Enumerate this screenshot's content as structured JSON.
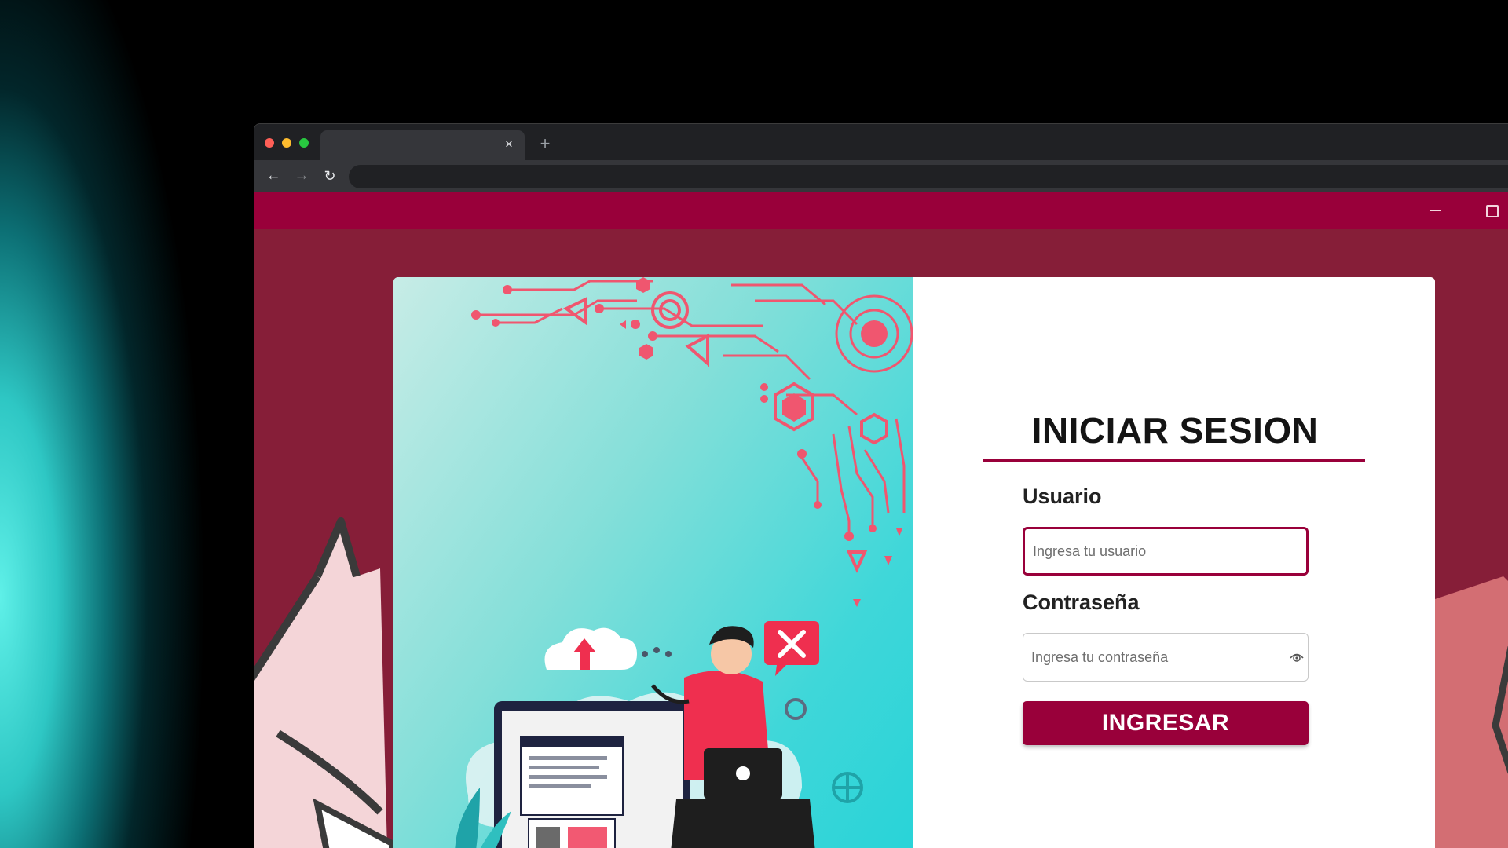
{
  "browser": {
    "tab_close_glyph": "×",
    "new_tab_glyph": "+",
    "nav_icons": [
      "back-arrow-icon",
      "forward-arrow-icon",
      "reload-icon"
    ],
    "back_glyph": "←",
    "forward_glyph": "→",
    "reload_glyph": "↻"
  },
  "app": {
    "window_controls": [
      "minimize-icon",
      "maximize-icon"
    ]
  },
  "login": {
    "title": "INICIAR SESION",
    "username_label": "Usuario",
    "username_placeholder": "Ingresa tu usuario",
    "password_label": "Contraseña",
    "password_placeholder": "Ingresa tu contraseña",
    "submit_label": "INGRESAR"
  },
  "colors": {
    "brand": "#99003a",
    "page_background": "#861e38",
    "illustration_gradient_start": "#c7ece6",
    "illustration_gradient_end": "#27d3d8",
    "circuit_accent": "#f0566f"
  }
}
